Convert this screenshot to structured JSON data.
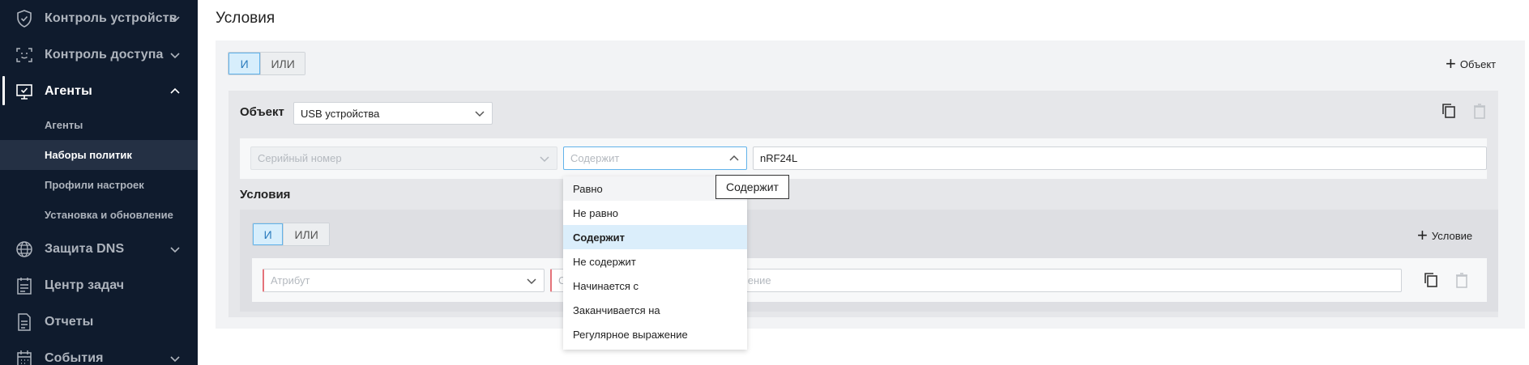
{
  "sidebar": {
    "items": [
      {
        "label": "Контроль устройств",
        "icon": "shield-check-icon"
      },
      {
        "label": "Контроль доступа",
        "icon": "scan-face-icon"
      },
      {
        "label": "Агенты",
        "icon": "monitor-check-icon"
      },
      {
        "label": "Защита DNS",
        "icon": "globe-icon"
      },
      {
        "label": "Центр задач",
        "icon": "clipboard-list-icon"
      },
      {
        "label": "Отчеты",
        "icon": "document-icon"
      },
      {
        "label": "События",
        "icon": "calendar-icon"
      }
    ],
    "sub_items": [
      {
        "label": "Агенты"
      },
      {
        "label": "Наборы политик"
      },
      {
        "label": "Профили настроек"
      },
      {
        "label": "Установка и обновление"
      }
    ]
  },
  "main": {
    "title": "Условия",
    "top_logic": {
      "and": "И",
      "or": "ИЛИ"
    },
    "add_object": "Объект",
    "object": {
      "label": "Объект",
      "type_value": "USB устройства",
      "field_placeholder": "Серийный номер",
      "operator_placeholder": "Содержит",
      "value": "nRF24L"
    },
    "conditions": {
      "label": "Условия",
      "logic": {
        "and": "И",
        "or": "ИЛИ"
      },
      "add_condition": "Условие",
      "attribute_placeholder": "Атрибут",
      "operator_placeholder_partial": "С",
      "value_placeholder_partial": "ачение"
    }
  },
  "dropdown": {
    "options": [
      "Равно",
      "Не равно",
      "Содержит",
      "Не содержит",
      "Начинается с",
      "Заканчивается на",
      "Регулярное выражение"
    ],
    "selected": "Содержит"
  },
  "tooltip": "Содержит",
  "colors": {
    "sidebar_bg": "#0f1b2d",
    "accent": "#62b3ea",
    "selected_option": "#dbeefb",
    "error": "#e5737a"
  }
}
